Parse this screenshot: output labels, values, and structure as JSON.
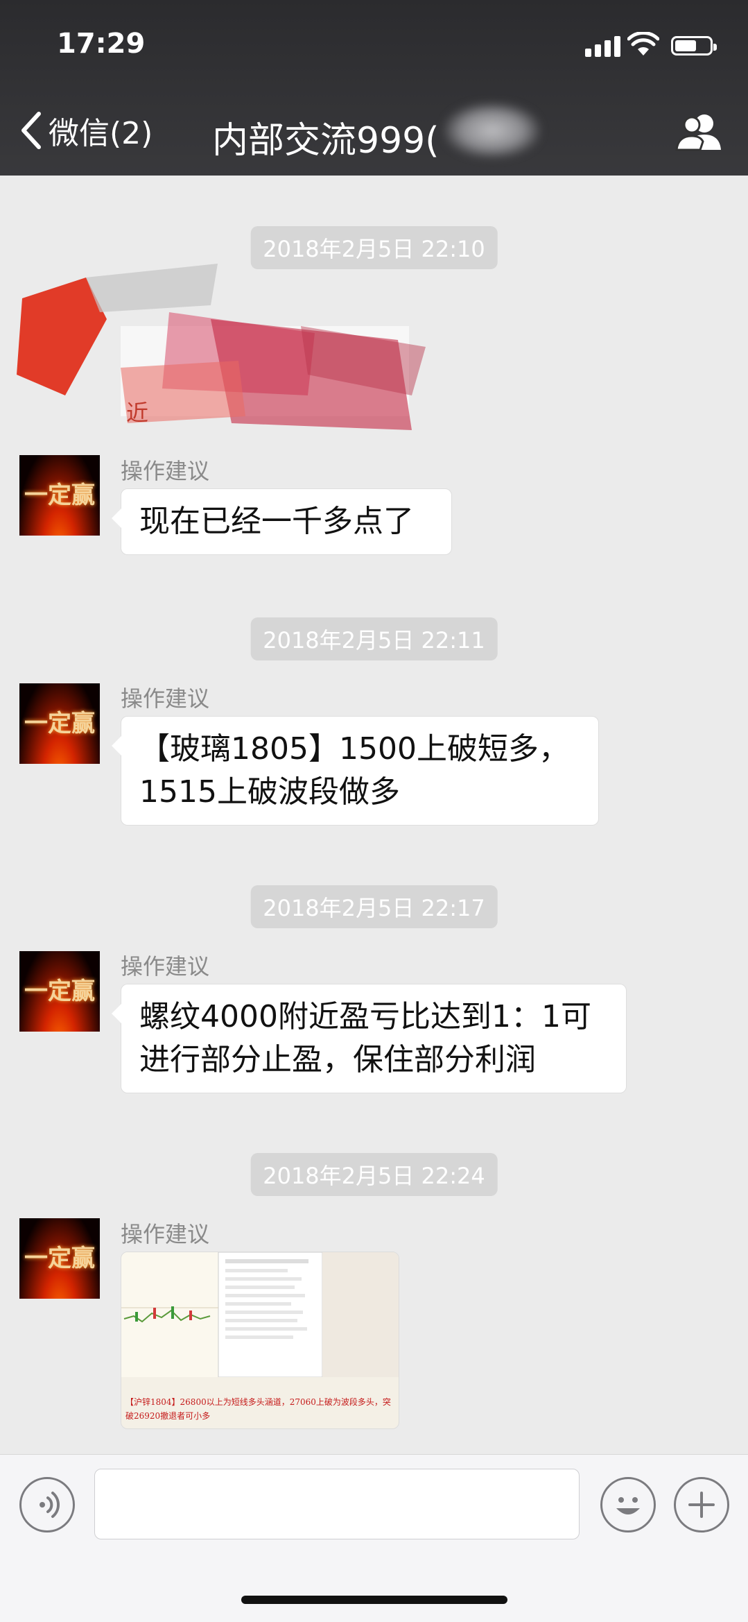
{
  "status_bar": {
    "time": "17:29"
  },
  "nav": {
    "back_label": "微信(2)",
    "title": "内部交流999("
  },
  "messages": [
    {
      "timestamp": "2018年2月5日 22:10",
      "redacted_fragment": "近"
    },
    {
      "sender": "操作建议",
      "avatar_text": "一定赢",
      "text": "现在已经一千多点了"
    },
    {
      "timestamp": "2018年2月5日 22:11"
    },
    {
      "sender": "操作建议",
      "avatar_text": "一定赢",
      "text": "【玻璃1805】1500上破短多，\n1515上破波段做多"
    },
    {
      "timestamp": "2018年2月5日 22:17"
    },
    {
      "sender": "操作建议",
      "avatar_text": "一定赢",
      "text": "螺纹4000附近盈亏比达到1：1可\n进行部分止盈，保住部分利润"
    },
    {
      "timestamp": "2018年2月5日 22:24"
    },
    {
      "sender": "操作建议",
      "avatar_text": "一定赢",
      "image_caption": "【沪锌1804】26800以上为短线多头涵道，27060上破为波段多头，突破26920撤退者可小多"
    }
  ],
  "colors": {
    "topbar": "#2b2b2e",
    "chat_bg": "#ebebeb",
    "timestamp_bg": "#d6d6d6",
    "bubble": "#ffffff"
  },
  "icons": [
    "back-chevron-icon",
    "group-members-icon",
    "voice-icon",
    "emoji-icon",
    "plus-icon"
  ]
}
